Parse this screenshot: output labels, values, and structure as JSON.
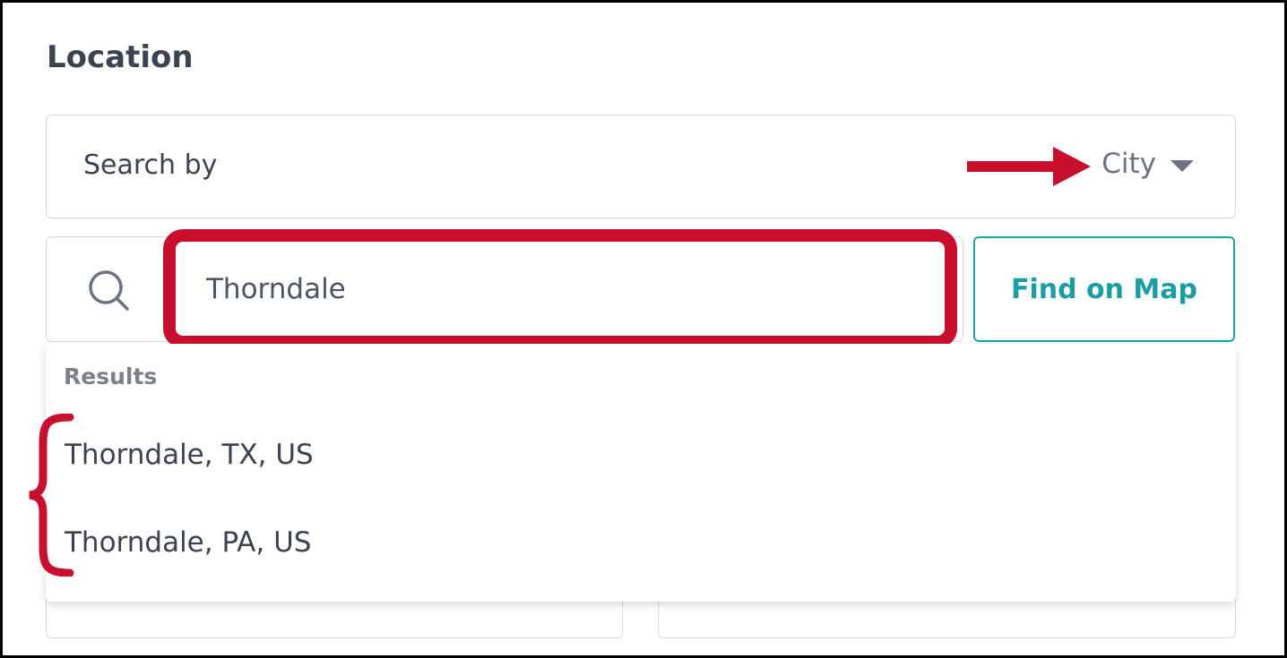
{
  "location": {
    "title": "Location",
    "search_by_label": "Search by",
    "search_by_value": "City",
    "search_input_value": "Thorndale",
    "find_button_label": "Find on Map",
    "results_heading": "Results",
    "results": [
      "Thorndale, TX, US",
      "Thorndale, PA, US"
    ]
  },
  "colors": {
    "annotation_red": "#c8102e",
    "accent_teal": "#1a9ea3",
    "text_dark": "#3b4252",
    "text_muted": "#7b808a"
  },
  "icons": [
    "search-icon",
    "caret-down-icon",
    "arrow-right-icon",
    "curly-brace-icon"
  ]
}
